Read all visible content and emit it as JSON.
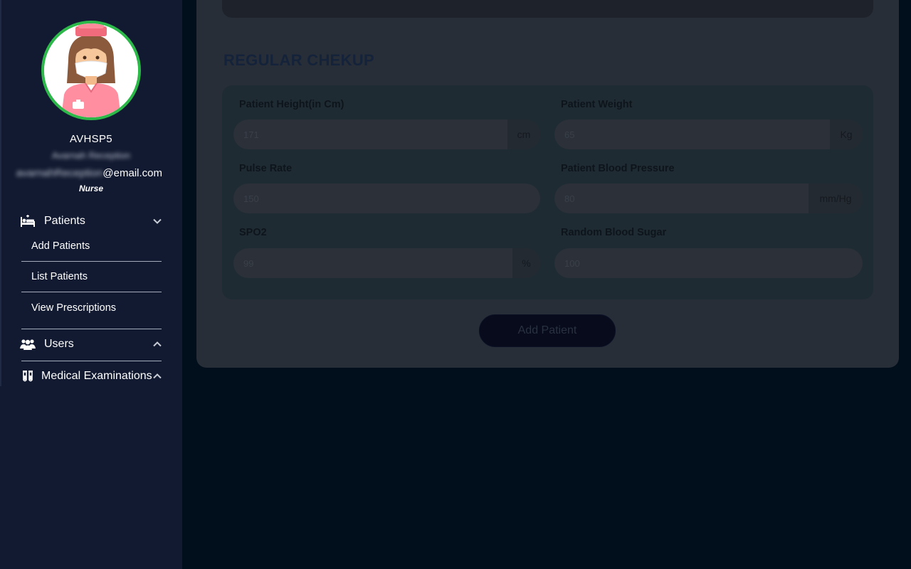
{
  "profile": {
    "name": "AVHSP5",
    "subtitle": "Avarnah Reception",
    "email_hidden": "avarnahReception",
    "email_domain": "@email.com",
    "role": "Nurse",
    "avatar_icon": "nurse-avatar-icon"
  },
  "nav": {
    "patients": {
      "label": "Patients",
      "icon": "hospital-bed-icon",
      "expanded": true
    },
    "patients_items": [
      {
        "label": "Add Patients"
      },
      {
        "label": "List Patients"
      },
      {
        "label": "View Prescriptions"
      }
    ],
    "users": {
      "label": "Users",
      "icon": "users-icon",
      "expanded": false
    },
    "medical": {
      "label": "Medical Examinations",
      "icon": "test-tubes-icon",
      "expanded": false
    }
  },
  "form": {
    "section_title": "REGULAR CHEKUP",
    "fields": {
      "height": {
        "label": "Patient Height(in Cm)",
        "placeholder": "171",
        "unit": "cm"
      },
      "weight": {
        "label": "Patient Weight",
        "placeholder": "65",
        "unit": "Kg"
      },
      "pulse": {
        "label": "Pulse Rate",
        "placeholder": "150"
      },
      "bp": {
        "label": "Patient Blood Pressure",
        "placeholder": "80",
        "unit": "mm/Hg"
      },
      "spo2": {
        "label": "SPO2",
        "placeholder": "99",
        "unit": "%"
      },
      "sugar": {
        "label": "Random Blood Sugar",
        "placeholder": "100"
      }
    },
    "submit_label": "Add Patient"
  },
  "colors": {
    "sidebar_bg": "#121a31",
    "page_bg": "#010f1c",
    "avatar_ring": "#2db84a",
    "overlay_card": "#272e38"
  }
}
